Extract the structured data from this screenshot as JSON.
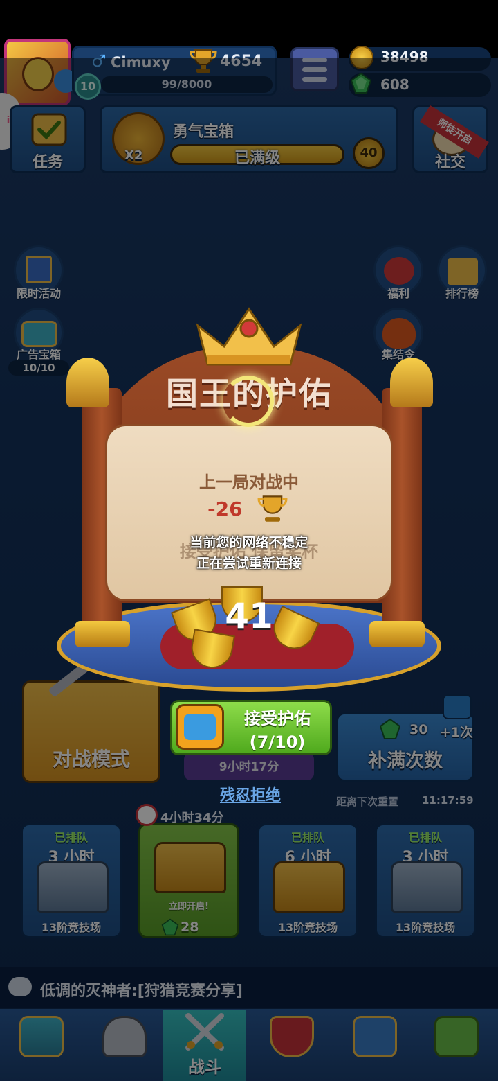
{
  "player": {
    "name": "Cimuxy",
    "level": "10",
    "trophies": "4654",
    "xp": "99/8000"
  },
  "currency": {
    "coins": "38498",
    "gems": "608"
  },
  "top_buttons": {
    "tasks_label": "任务",
    "chest_title": "勇气宝箱",
    "chest_multiplier": "X2",
    "chest_status": "已满级",
    "chest_count": "40",
    "social_ribbon": "师徒开启",
    "social_label": "社交"
  },
  "side_left": [
    {
      "label": "限时活动"
    },
    {
      "label": "广告宝箱",
      "count": "10/10"
    }
  ],
  "side_right": [
    {
      "label": "福利"
    },
    {
      "label": "排行榜"
    },
    {
      "label": "集结令"
    }
  ],
  "modal": {
    "title": "国王的护佑",
    "subtitle": "上一局对战中",
    "delta": "-26",
    "obscured_text": "接受护佑 保留奖杯",
    "toast_line1": "当前您的网络不稳定",
    "toast_line2": "正在尝试重新连接",
    "trophies_kept": "41",
    "accept_label": "接受护佑",
    "accept_progress": "(7/10)",
    "refuse_label": "残忍拒绝"
  },
  "battle": {
    "mode_label": "对战模式",
    "timer": "9小时17分",
    "refill_label": "补满次数",
    "refill_cost": "30",
    "refill_plus": "+1次",
    "reset_text": "距离下次重置",
    "reset_time": "11:17:59"
  },
  "chest_slots": [
    {
      "tag": "已排队",
      "hours": "3 小时",
      "arena": "13阶竞技场",
      "type": "silver"
    },
    {
      "open_label": "立即开启!",
      "cost": "28",
      "timer": "4小时34分",
      "type": "gold"
    },
    {
      "tag": "已排队",
      "hours": "6 小时",
      "arena": "13阶竞技场",
      "type": "gold"
    },
    {
      "tag": "已排队",
      "hours": "3 小时",
      "arena": "13阶竞技场",
      "type": "silver"
    }
  ],
  "chat": {
    "message": "低调的灭神者:[狩猎竞赛分享]"
  },
  "nav": [
    {
      "icon": "chest-icon"
    },
    {
      "icon": "helmet-icon"
    },
    {
      "icon": "crossed-swords-icon",
      "label": "战斗"
    },
    {
      "icon": "shield-crown-icon"
    },
    {
      "icon": "clan-banner-icon"
    },
    {
      "icon": "sprout-icon"
    }
  ],
  "colors": {
    "accent_green": "#5fb82a",
    "panel_blue": "#2c69a8",
    "gold": "#f2c04a"
  }
}
